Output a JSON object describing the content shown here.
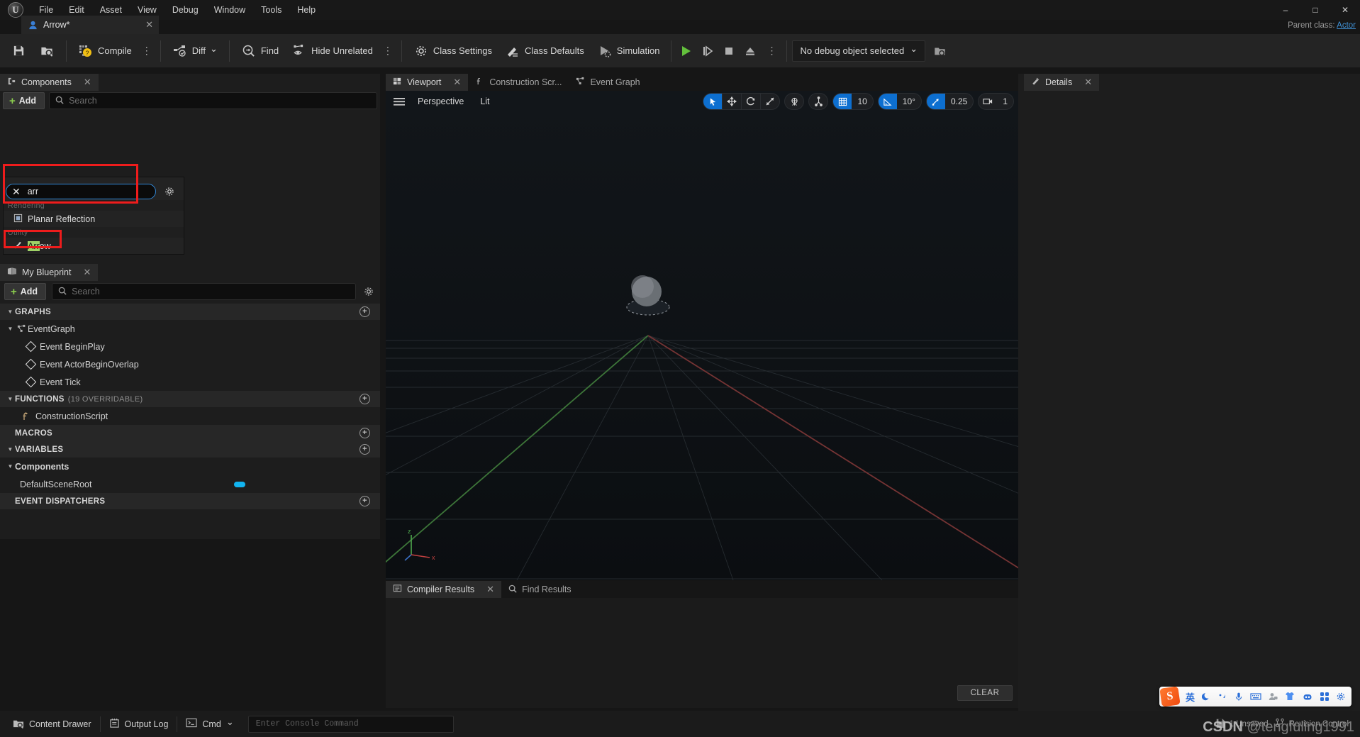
{
  "app": {
    "title": "Arrow*",
    "parent_class_label": "Parent class:",
    "parent_class_value": "Actor"
  },
  "menubar": {
    "items": [
      "File",
      "Edit",
      "Asset",
      "View",
      "Debug",
      "Window",
      "Tools",
      "Help"
    ]
  },
  "window_controls": {
    "minimize": "–",
    "maximize": "□",
    "close": "✕"
  },
  "asset_tab": {
    "label": "Arrow*",
    "close": "✕",
    "icon": "blueprint-icon"
  },
  "toolbar": {
    "save_icon": "save-icon",
    "browse_icon": "browse-content-icon",
    "compile_label": "Compile",
    "compile_icon": "compile-icon",
    "kebab": "⋮",
    "diff_label": "Diff",
    "diff_caret": "⌄",
    "find_label": "Find",
    "hide_unrelated_label": "Hide Unrelated",
    "class_settings_label": "Class Settings",
    "class_defaults_label": "Class Defaults",
    "simulation_label": "Simulation",
    "play_icon": "play-icon",
    "step_icon": "step-icon",
    "stop_icon": "stop-icon",
    "eject_icon": "eject-icon",
    "debug_object_label": "No debug object selected",
    "debug_caret": "⌄",
    "debug_browse_icon": "browse-icon"
  },
  "components_panel": {
    "tab_label": "Components",
    "tab_icon": "components-icon",
    "tab_close": "✕",
    "add_label": "Add",
    "search_placeholder": "Search",
    "search_value": "arr",
    "clear_glyph": "✕",
    "gear_icon": "gear-icon",
    "dropdown": {
      "sections": [
        {
          "title": "Rendering",
          "items": [
            {
              "label": "Planar Reflection",
              "highlight": "",
              "icon": "planar-reflection-icon"
            }
          ]
        },
        {
          "title": "Utility",
          "items": [
            {
              "label": "Arrow",
              "highlight": "Arr",
              "rest": "ow",
              "icon": "arrow-component-icon"
            }
          ]
        }
      ]
    }
  },
  "my_blueprint_panel": {
    "tab_label": "My Blueprint",
    "tab_icon": "book-icon",
    "tab_close": "✕",
    "add_label": "Add",
    "search_placeholder": "Search",
    "gear_icon": "gear-icon",
    "sections": [
      {
        "title": "GRAPHS",
        "sub": "",
        "expanded": true,
        "has_add": true,
        "rows": [
          {
            "label": "EventGraph",
            "indent": 0,
            "icon": "graph-icon",
            "tri": "▼"
          },
          {
            "label": "Event BeginPlay",
            "indent": 1,
            "icon": "event-node-icon",
            "tri": ""
          },
          {
            "label": "Event ActorBeginOverlap",
            "indent": 1,
            "icon": "event-node-icon",
            "tri": ""
          },
          {
            "label": "Event Tick",
            "indent": 1,
            "icon": "event-node-icon",
            "tri": ""
          }
        ]
      },
      {
        "title": "FUNCTIONS",
        "sub": "(19 OVERRIDABLE)",
        "expanded": true,
        "has_add": true,
        "rows": [
          {
            "label": "ConstructionScript",
            "indent": 1,
            "icon": "function-icon",
            "tri": ""
          }
        ]
      },
      {
        "title": "MACROS",
        "sub": "",
        "expanded": false,
        "has_add": true,
        "rows": []
      },
      {
        "title": "VARIABLES",
        "sub": "",
        "expanded": true,
        "has_add": true,
        "rows": []
      }
    ],
    "components_group": {
      "label": "Components",
      "tri": "▼"
    },
    "components_rows": [
      {
        "label": "DefaultSceneRoot",
        "pill_color": "#12b4f0"
      }
    ],
    "event_dispatchers": {
      "title": "EVENT DISPATCHERS",
      "has_add": true
    }
  },
  "center_tabs": [
    {
      "label": "Viewport",
      "icon": "viewport-icon",
      "active": true,
      "close": "✕"
    },
    {
      "label": "Construction Scr...",
      "icon": "function-icon",
      "active": false,
      "close": ""
    },
    {
      "label": "Event Graph",
      "icon": "graph-icon",
      "active": false,
      "close": ""
    }
  ],
  "viewport": {
    "menu_icon": "viewport-menu-icon",
    "perspective_label": "Perspective",
    "lit_label": "Lit",
    "tools": {
      "select_icon": "select-arrow-icon",
      "move_icon": "move-icon",
      "rotate_icon": "rotate-icon",
      "scale_icon": "scale-icon",
      "coord_icon": "world-coord-icon",
      "surface_snap_icon": "surface-snap-icon",
      "grid_snap_icon": "grid-snap-icon",
      "grid_snap_value": "10",
      "angle_snap_icon": "angle-snap-icon",
      "angle_snap_value": "10°",
      "scale_snap_icon": "scale-snap-icon",
      "scale_snap_value": "0.25",
      "camera_speed_icon": "camera-icon",
      "camera_speed_value": "1"
    }
  },
  "details_panel": {
    "tab_label": "Details",
    "tab_icon": "details-icon",
    "tab_close": "✕"
  },
  "bottom_tabs": [
    {
      "label": "Compiler Results",
      "icon": "compiler-icon",
      "active": true,
      "close": "✕"
    },
    {
      "label": "Find Results",
      "icon": "search-icon",
      "active": false,
      "close": ""
    }
  ],
  "compiler_results": {
    "clear_label": "CLEAR"
  },
  "statusbar": {
    "content_drawer_label": "Content Drawer",
    "content_drawer_icon": "drawer-icon",
    "output_log_label": "Output Log",
    "output_log_icon": "log-icon",
    "cmd_label": "Cmd",
    "cmd_icon": "cmd-icon",
    "cmd_caret": "⌄",
    "console_placeholder": "Enter Console Command",
    "unsaved_label": "1 Unsaved",
    "unsaved_icon": "save-icon",
    "revision_label": "Revision Control",
    "revision_icon": "branch-icon"
  },
  "ime_bar": {
    "logo": "S",
    "items": [
      "英",
      "moon-icon",
      "punct-icon",
      "mic-icon",
      "keyboard-icon",
      "user-icon",
      "skin-icon",
      "robot-icon",
      "apps-icon",
      "settings-icon"
    ]
  },
  "watermark": {
    "csdn": "CSDN",
    "handle": "@tengfuling1991"
  },
  "colors": {
    "accent_blue": "#0d6fd0",
    "highlight_green": "#9fd166",
    "redbox": "#ee1c1c",
    "pill_blue": "#12b4f0",
    "add_plus_green": "#8ccf4e"
  }
}
